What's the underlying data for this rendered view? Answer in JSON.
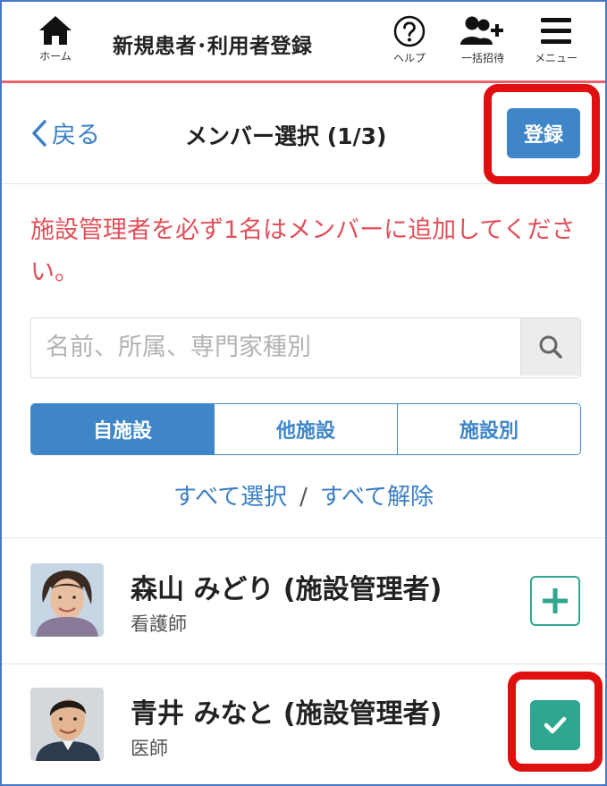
{
  "topnav": {
    "home_label": "ホーム",
    "app_title": "新規患者･利用者登録",
    "help_label": "ヘルプ",
    "invite_label": "一括招待",
    "menu_label": "メニュー",
    "accent_color": "#e8606a"
  },
  "subheader": {
    "back_label": "戻る",
    "title": "メンバー選択 (1/3)",
    "register_label": "登録"
  },
  "warning_text": "施設管理者を必ず1名はメンバーに追加してください。",
  "search": {
    "placeholder": "名前、所属、専門家種別",
    "value": ""
  },
  "segments": [
    {
      "label": "自施設",
      "active": true
    },
    {
      "label": "他施設",
      "active": false
    },
    {
      "label": "施設別",
      "active": false
    }
  ],
  "select": {
    "select_all": "すべて選択",
    "separator": "/",
    "deselect_all": "すべて解除"
  },
  "members": [
    {
      "name": "森山 みどり (施設管理者)",
      "role": "看護師",
      "selected": false
    },
    {
      "name": "青井 みなと (施設管理者)",
      "role": "医師",
      "selected": true
    }
  ],
  "colors": {
    "primary": "#3f86c9",
    "warning": "#e0505a",
    "teal": "#2fa68e",
    "highlight": "#e01010"
  }
}
